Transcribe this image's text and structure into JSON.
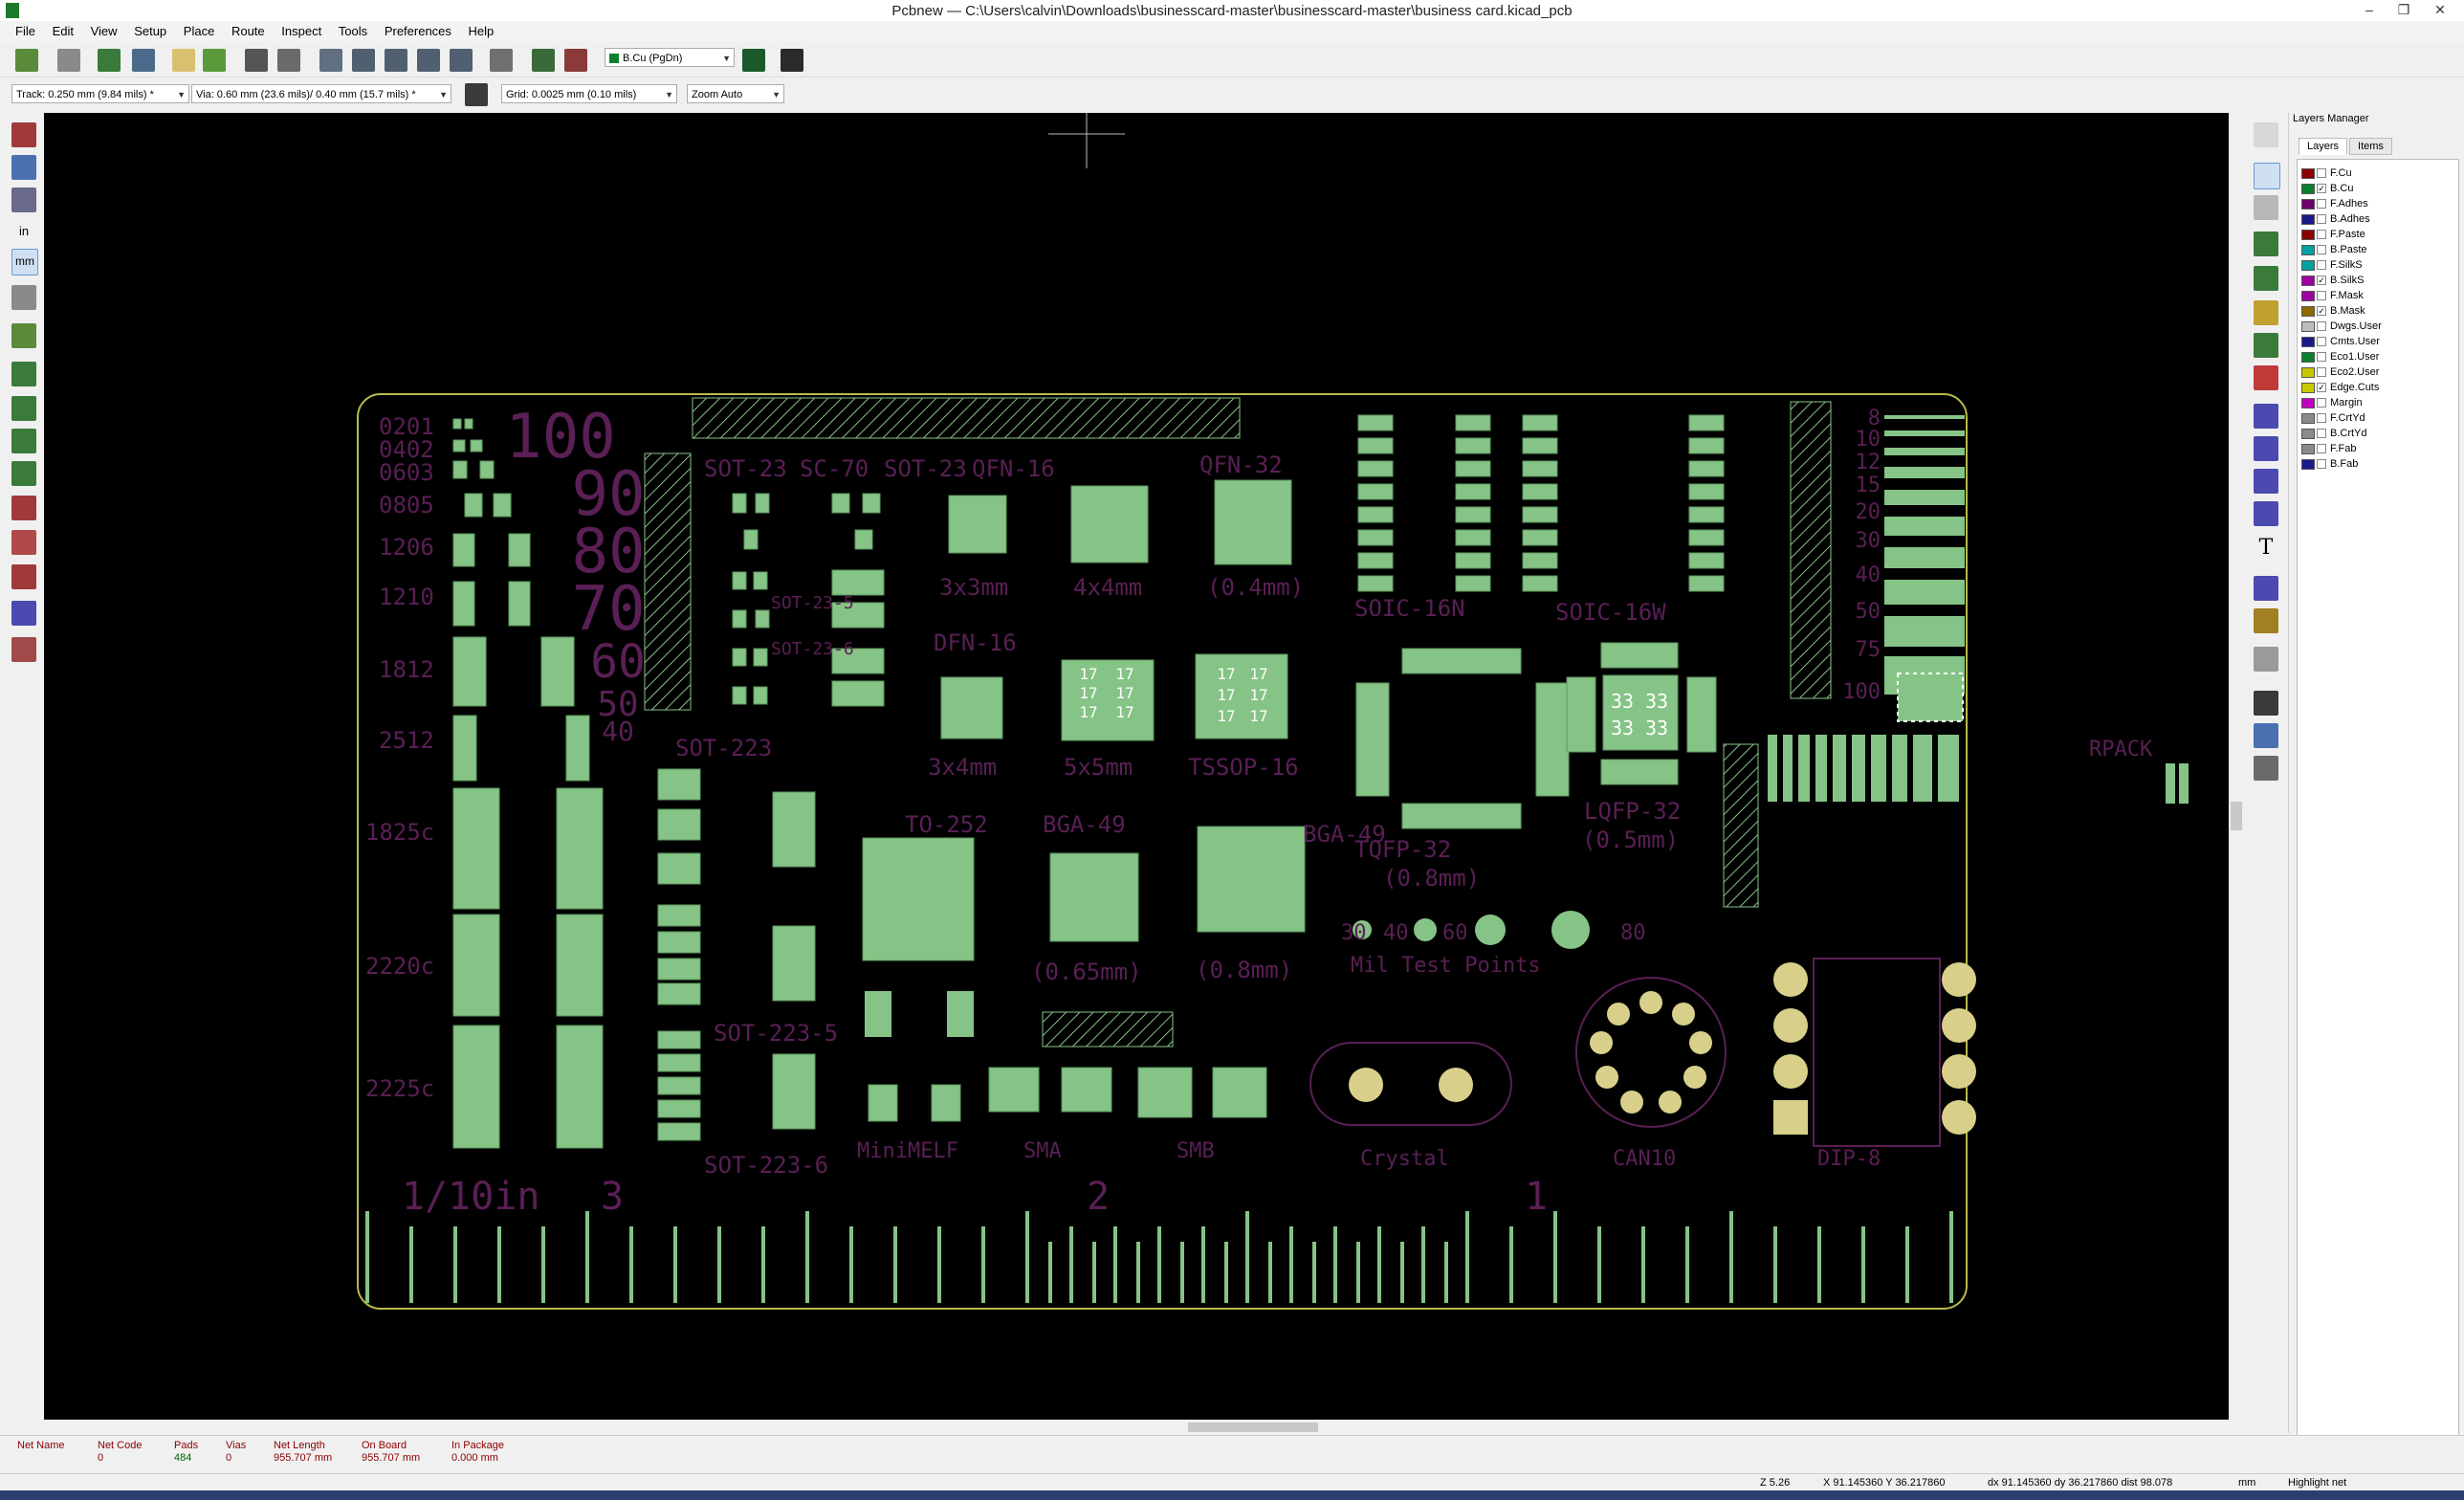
{
  "window": {
    "title": "Pcbnew — C:\\Users\\calvin\\Downloads\\businesscard-master\\businesscard-master\\business card.kicad_pcb",
    "minimize": "–",
    "restore": "❐",
    "close": "✕"
  },
  "menu": [
    "File",
    "Edit",
    "View",
    "Setup",
    "Place",
    "Route",
    "Inspect",
    "Tools",
    "Preferences",
    "Help"
  ],
  "toolbar": {
    "active_layer": "B.Cu (PgDn)"
  },
  "aux_toolbar": {
    "track": "Track: 0.250 mm (9.84 mils) *",
    "via": "Via: 0.60 mm (23.6 mils)/ 0.40 mm (15.7 mils) *",
    "grid": "Grid: 0.0025 mm (0.10 mils)",
    "zoom": "Zoom Auto"
  },
  "left_toolbar": {
    "unit_in": "in",
    "unit_mm": "mm"
  },
  "layers_manager": {
    "title": "Layers Manager",
    "tabs": [
      "Layers",
      "Items"
    ],
    "layers": [
      {
        "name": "F.Cu",
        "color": "#8b0000",
        "checked": false
      },
      {
        "name": "B.Cu",
        "color": "#0a7f2e",
        "checked": true
      },
      {
        "name": "F.Adhes",
        "color": "#6b006b",
        "checked": false
      },
      {
        "name": "B.Adhes",
        "color": "#1a1a8a",
        "checked": false
      },
      {
        "name": "F.Paste",
        "color": "#8b0000",
        "checked": false
      },
      {
        "name": "B.Paste",
        "color": "#00a0a0",
        "checked": false
      },
      {
        "name": "F.SilkS",
        "color": "#00a0a0",
        "checked": false
      },
      {
        "name": "B.SilkS",
        "color": "#a000a0",
        "checked": true
      },
      {
        "name": "F.Mask",
        "color": "#a000a0",
        "checked": false
      },
      {
        "name": "B.Mask",
        "color": "#8b6b00",
        "checked": true
      },
      {
        "name": "Dwgs.User",
        "color": "#bdbdbd",
        "checked": false
      },
      {
        "name": "Cmts.User",
        "color": "#1a1a8a",
        "checked": false
      },
      {
        "name": "Eco1.User",
        "color": "#0a7f2e",
        "checked": false
      },
      {
        "name": "Eco2.User",
        "color": "#c8c800",
        "checked": false
      },
      {
        "name": "Edge.Cuts",
        "color": "#c8c800",
        "checked": true
      },
      {
        "name": "Margin",
        "color": "#c000c0",
        "checked": false
      },
      {
        "name": "F.CrtYd",
        "color": "#8a8a8a",
        "checked": false
      },
      {
        "name": "B.CrtYd",
        "color": "#8a8a8a",
        "checked": false
      },
      {
        "name": "F.Fab",
        "color": "#8a8a8a",
        "checked": false
      },
      {
        "name": "B.Fab",
        "color": "#1a1a8a",
        "checked": false
      }
    ]
  },
  "board": {
    "passive_sizes": [
      "0201",
      "0402",
      "0603",
      "0805",
      "1206",
      "1210",
      "1812",
      "2512",
      "1825c",
      "2220c",
      "2225c"
    ],
    "ruler_big": [
      "100",
      "90",
      "80",
      "70",
      "60",
      "50",
      "40"
    ],
    "ruler_small": [
      "8",
      "10",
      "12",
      "15",
      "20",
      "30",
      "40",
      "50",
      "75",
      "100"
    ],
    "packages_top": [
      "SOT-23",
      "SC-70",
      "SOT-23",
      "SOT-23-5",
      "SOT-23-6",
      "QFN-16",
      "QFN-32",
      "3x3mm",
      "4x4mm",
      "(0.4mm)",
      "DFN-16",
      "3x4mm",
      "5x5mm",
      "TSSOP-16"
    ],
    "soic": [
      "SOIC-16N",
      "SOIC-16W"
    ],
    "sot223": [
      "SOT-223",
      "SOT-223-5",
      "SOT-223-6"
    ],
    "to252": "TO-252",
    "bga": [
      "BGA-49",
      "BGA-49",
      "(0.65mm)",
      "(0.8mm)"
    ],
    "tqfp": [
      "TQFP-32",
      "(0.8mm)",
      "LQFP-32",
      "(0.5mm)"
    ],
    "testpoints": [
      "80",
      "60",
      "40",
      "30",
      "Mil Test Points"
    ],
    "diodes": [
      "MiniMELF",
      "SMA",
      "SMB"
    ],
    "misc": [
      "Crystal",
      "CAN10",
      "DIP-8",
      "RPACK"
    ],
    "ruler_bottom": [
      "1/10in",
      "3",
      "2",
      "1"
    ],
    "pad_17": "17",
    "pad_33": "33"
  },
  "message_panel": [
    {
      "label": "Net Name",
      "value": ""
    },
    {
      "label": "Net Code",
      "value": "0"
    },
    {
      "label": "Pads",
      "value": "484"
    },
    {
      "label": "Vias",
      "value": "0"
    },
    {
      "label": "Net Length",
      "value": "955.707 mm"
    },
    {
      "label": "On Board",
      "value": "955.707 mm"
    },
    {
      "label": "In Package",
      "value": "0.000 mm"
    }
  ],
  "status": {
    "zoom": "Z 5.26",
    "xy": "X 91.145360  Y 36.217860",
    "dxy": "dx 91.145360  dy 36.217860  dist 98.078",
    "units": "mm",
    "mode": "Highlight net"
  }
}
